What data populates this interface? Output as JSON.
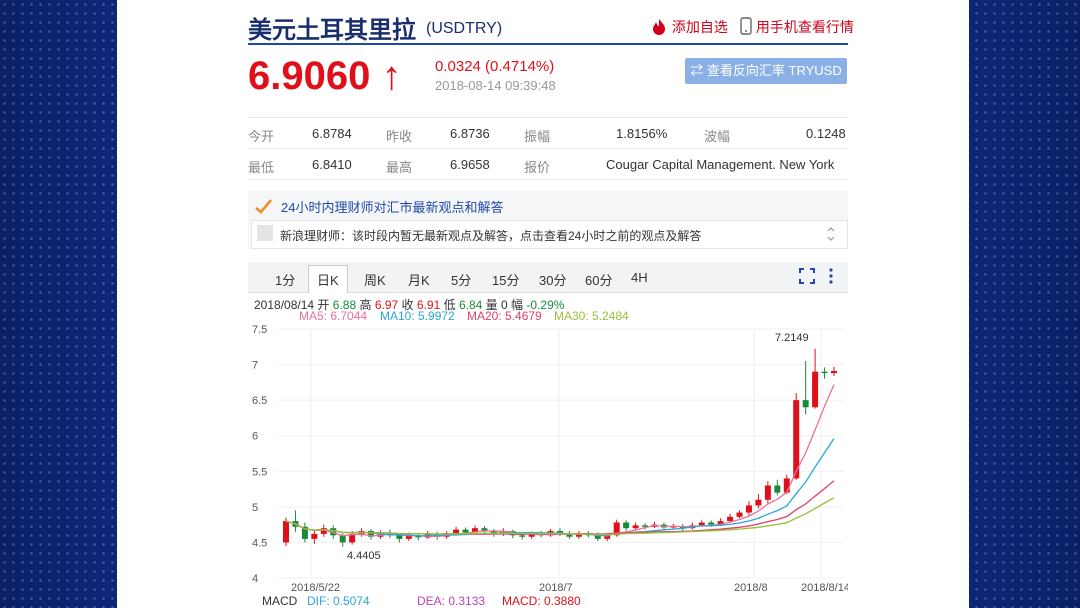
{
  "header": {
    "title": "美元土耳其里拉",
    "code": "(USDTRY)",
    "add_watch": "添加自选",
    "mobile_view": "用手机查看行情"
  },
  "quote": {
    "price": "6.9060",
    "arrow": "↑",
    "change": "0.0324 (0.4714%)",
    "time": "2018-08-14 09:39:48",
    "reverse_button": "⇄ 查看反向汇率 TRYUSD"
  },
  "stats": {
    "open_label": "今开",
    "open": "6.8784",
    "prev_label": "昨收",
    "prev": "6.8736",
    "amp_label": "振幅",
    "amp": "1.8156%",
    "wave_label": "波幅",
    "wave": "0.1248",
    "low_label": "最低",
    "low": "6.8410",
    "high_label": "最高",
    "high": "6.9658",
    "quote_label": "报价",
    "quote_src": "Cougar Capital Management. New York"
  },
  "advisor": {
    "title": "24小时内理财师对汇市最新观点和解答",
    "message": "新浪理财师：该时段内暂无最新观点及解答，点击查看24小时之前的观点及解答"
  },
  "tabs": [
    "1分",
    "日K",
    "周K",
    "月K",
    "5分",
    "15分",
    "30分",
    "60分",
    "4H"
  ],
  "active_tab": "日K",
  "kline_info": {
    "date": "2018/08/14",
    "open_label": "开",
    "open": "6.88",
    "high_label": "高",
    "high": "6.97",
    "close_label": "收",
    "close": "6.91",
    "low_label": "低",
    "low": "6.84",
    "vol_label": "量",
    "vol": "0",
    "amp_label": "幅",
    "amp": "-0.29%"
  },
  "ma": {
    "ma5": "MA5: 6.7044",
    "ma10": "MA10: 5.9972",
    "ma20": "MA20: 5.4679",
    "ma30": "MA30: 5.2484"
  },
  "macd": {
    "label": "MACD",
    "dif": "DIF: 0.5074",
    "dea": "DEA: 0.3133",
    "macd": "MACD: 0.3880"
  },
  "colors": {
    "up": "#e0101a",
    "down": "#1a8a3a",
    "ma5": "#e8729a",
    "ma10": "#2aa7d8",
    "ma20": "#e0406a",
    "ma30": "#98c23a"
  },
  "chart_data": {
    "type": "candlestick",
    "ylim": [
      4,
      7.5
    ],
    "yticks": [
      "7.5",
      "7",
      "6.5",
      "6",
      "5.5",
      "5",
      "4.5",
      "4"
    ],
    "xticks": [
      "2018/5/22",
      "2018/7",
      "2018/8",
      "2018/8/14"
    ],
    "annotations": [
      "7.2149",
      "4.4405"
    ],
    "candles": [
      [
        4.5,
        4.8,
        4.45,
        4.85
      ],
      [
        4.8,
        4.72,
        4.65,
        4.95
      ],
      [
        4.72,
        4.55,
        4.5,
        4.78
      ],
      [
        4.55,
        4.62,
        4.48,
        4.68
      ],
      [
        4.62,
        4.7,
        4.58,
        4.75
      ],
      [
        4.7,
        4.6,
        4.55,
        4.74
      ],
      [
        4.6,
        4.5,
        4.44,
        4.63
      ],
      [
        4.5,
        4.62,
        4.47,
        4.66
      ],
      [
        4.62,
        4.66,
        4.58,
        4.7
      ],
      [
        4.66,
        4.58,
        4.54,
        4.69
      ],
      [
        4.58,
        4.64,
        4.55,
        4.67
      ],
      [
        4.64,
        4.6,
        4.56,
        4.68
      ],
      [
        4.6,
        4.55,
        4.5,
        4.63
      ],
      [
        4.55,
        4.6,
        4.52,
        4.64
      ],
      [
        4.6,
        4.57,
        4.53,
        4.63
      ],
      [
        4.57,
        4.62,
        4.55,
        4.66
      ],
      [
        4.62,
        4.58,
        4.54,
        4.65
      ],
      [
        4.58,
        4.63,
        4.55,
        4.66
      ],
      [
        4.63,
        4.68,
        4.6,
        4.72
      ],
      [
        4.68,
        4.64,
        4.6,
        4.71
      ],
      [
        4.64,
        4.7,
        4.62,
        4.74
      ],
      [
        4.7,
        4.66,
        4.62,
        4.73
      ],
      [
        4.66,
        4.62,
        4.58,
        4.69
      ],
      [
        4.62,
        4.66,
        4.59,
        4.7
      ],
      [
        4.66,
        4.6,
        4.56,
        4.68
      ],
      [
        4.6,
        4.58,
        4.54,
        4.64
      ],
      [
        4.58,
        4.62,
        4.55,
        4.65
      ],
      [
        4.62,
        4.6,
        4.57,
        4.66
      ],
      [
        4.6,
        4.66,
        4.58,
        4.69
      ],
      [
        4.66,
        4.62,
        4.59,
        4.7
      ],
      [
        4.62,
        4.58,
        4.55,
        4.66
      ],
      [
        4.58,
        4.63,
        4.55,
        4.66
      ],
      [
        4.63,
        4.6,
        4.57,
        4.66
      ],
      [
        4.6,
        4.55,
        4.52,
        4.64
      ],
      [
        4.55,
        4.6,
        4.52,
        4.63
      ],
      [
        4.6,
        4.78,
        4.58,
        4.82
      ],
      [
        4.78,
        4.7,
        4.66,
        4.81
      ],
      [
        4.7,
        4.74,
        4.68,
        4.78
      ],
      [
        4.74,
        4.72,
        4.68,
        4.77
      ],
      [
        4.72,
        4.75,
        4.7,
        4.79
      ],
      [
        4.75,
        4.71,
        4.68,
        4.78
      ],
      [
        4.71,
        4.73,
        4.69,
        4.76
      ],
      [
        4.73,
        4.7,
        4.66,
        4.76
      ],
      [
        4.7,
        4.74,
        4.68,
        4.78
      ],
      [
        4.74,
        4.78,
        4.72,
        4.81
      ],
      [
        4.78,
        4.75,
        4.72,
        4.81
      ],
      [
        4.75,
        4.8,
        4.73,
        4.84
      ],
      [
        4.8,
        4.86,
        4.78,
        4.9
      ],
      [
        4.86,
        4.92,
        4.84,
        4.95
      ],
      [
        4.92,
        5.02,
        4.88,
        5.08
      ],
      [
        5.02,
        5.1,
        4.98,
        5.18
      ],
      [
        5.1,
        5.3,
        5.05,
        5.36
      ],
      [
        5.3,
        5.2,
        5.16,
        5.38
      ],
      [
        5.2,
        5.4,
        5.18,
        5.45
      ],
      [
        5.4,
        6.5,
        5.38,
        6.6
      ],
      [
        6.5,
        6.4,
        6.3,
        7.05
      ],
      [
        6.4,
        6.9,
        6.38,
        7.22
      ],
      [
        6.9,
        6.88,
        6.8,
        6.96
      ],
      [
        6.88,
        6.91,
        6.84,
        6.97
      ]
    ]
  }
}
